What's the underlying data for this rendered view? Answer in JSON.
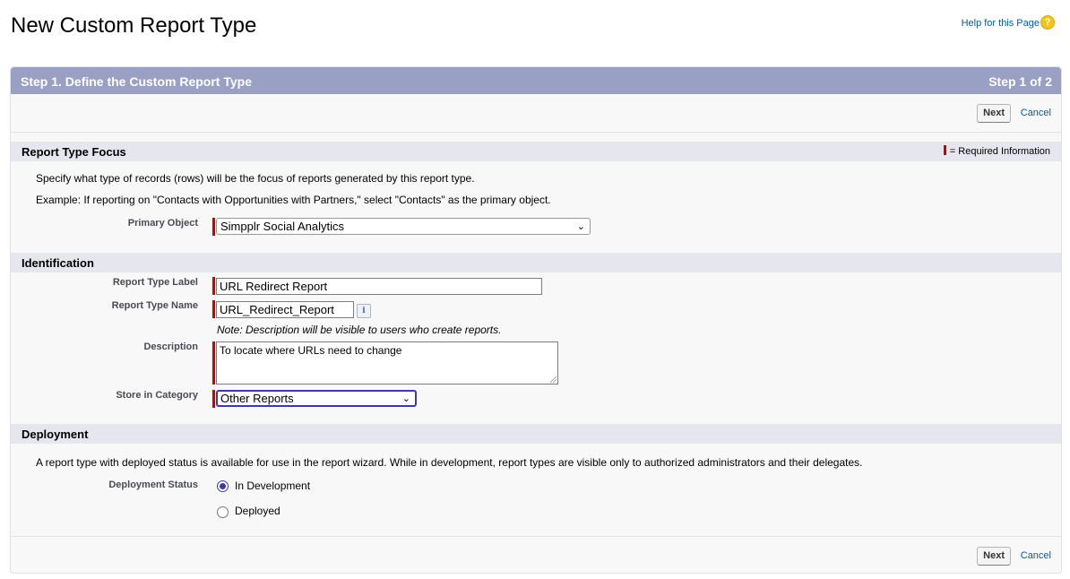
{
  "page": {
    "title": "New Custom Report Type",
    "help_link": "Help for this Page",
    "help_icon": "question-circle-icon"
  },
  "wizard": {
    "step_title": "Step 1. Define the Custom Report Type",
    "step_count": "Step 1 of 2",
    "next_label": "Next",
    "cancel_label": "Cancel"
  },
  "focus_section": {
    "title": "Report Type Focus",
    "required_legend": "= Required Information",
    "description": "Specify what type of records (rows) will be the focus of reports generated by this report type.",
    "example": "Example: If reporting on \"Contacts with Opportunities with Partners,\" select \"Contacts\" as the primary object.",
    "primary_object_label": "Primary Object",
    "primary_object_value": "Simpplr Social Analytics"
  },
  "identification": {
    "title": "Identification",
    "label_label": "Report Type Label",
    "label_value": "URL Redirect Report",
    "name_label": "Report Type Name",
    "name_value": "URL_Redirect_Report",
    "note": "Note: Description will be visible to users who create reports.",
    "description_label": "Description",
    "description_value": "To locate where URLs need to change",
    "category_label": "Store in Category",
    "category_value": "Other Reports"
  },
  "deployment": {
    "title": "Deployment",
    "text": "A report type with deployed status is available for use in the report wizard. While in development, report types are visible only to authorized administrators and their delegates.",
    "status_label": "Deployment Status",
    "option_development": "In Development",
    "option_deployed": "Deployed",
    "selected": "In Development"
  },
  "colors": {
    "header_bg": "#9a9fc4",
    "section_bg": "#e6e6ef",
    "required": "#cc0000",
    "link": "#015ba7"
  }
}
